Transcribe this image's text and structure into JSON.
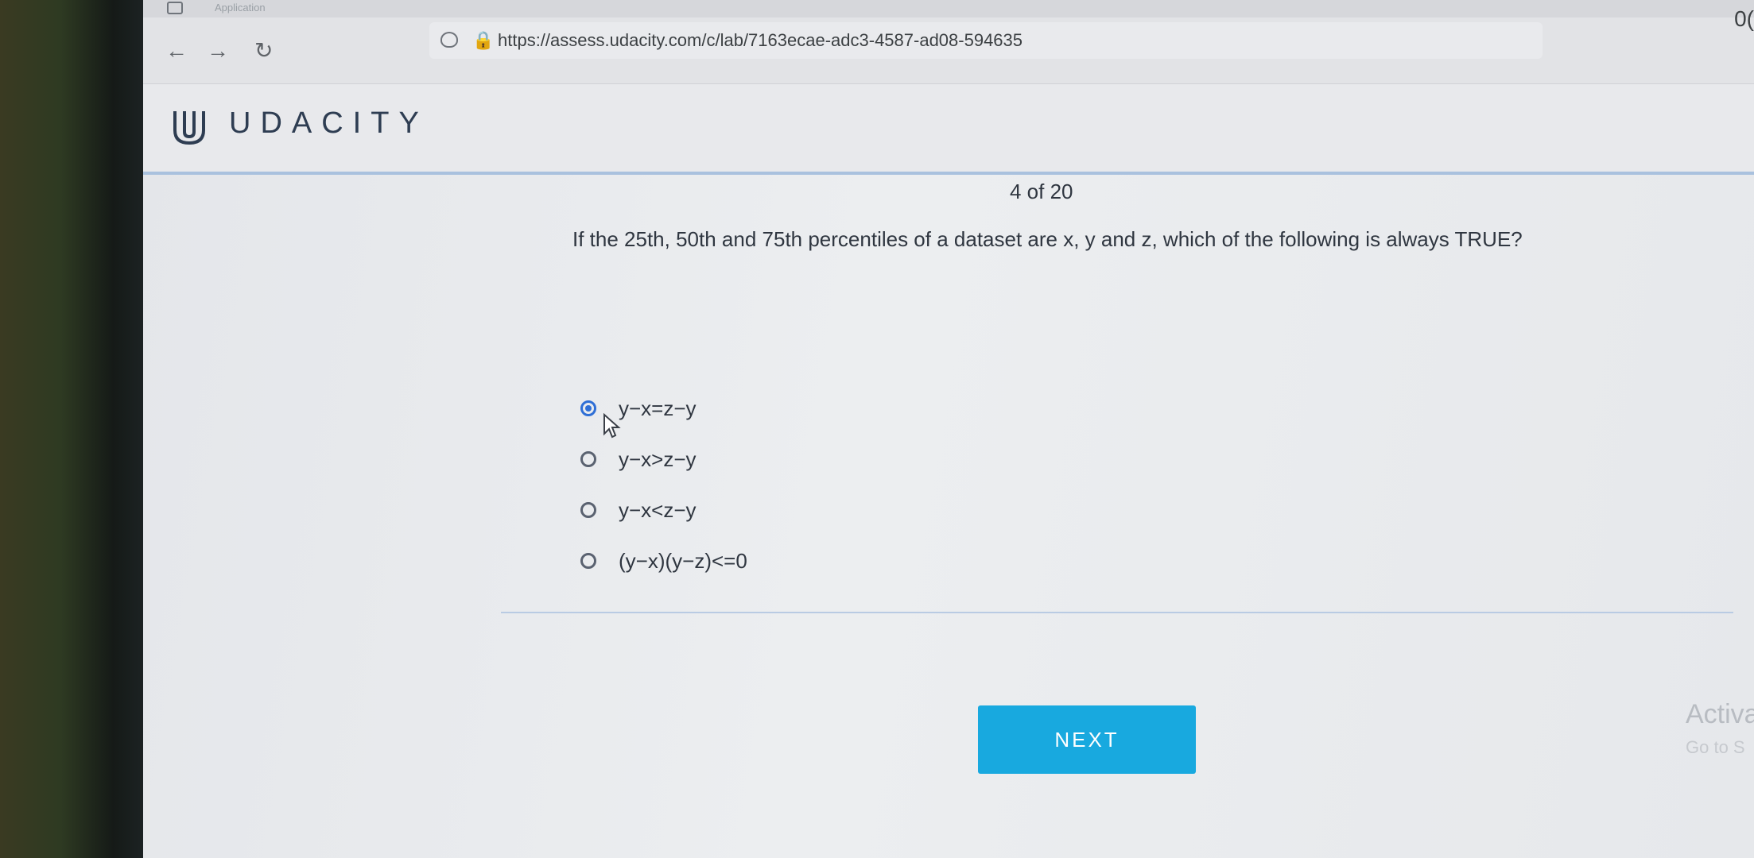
{
  "browser": {
    "tab_label": "Application",
    "url": "https://assess.udacity.com/c/lab/7163ecae-adc3-4587-ad08-594635",
    "corner_text": "0("
  },
  "header": {
    "logo_text": "UDACITY"
  },
  "quiz": {
    "counter": "4 of 20",
    "question": "If the 25th, 50th and 75th percentiles of a dataset are x, y and z, which of the following is always TRUE?",
    "options": [
      {
        "label": "y−x=z−y",
        "selected": true
      },
      {
        "label": "y−x>z−y",
        "selected": false
      },
      {
        "label": "y−x<z−y",
        "selected": false
      },
      {
        "label": "(y−x)(y−z)<=0",
        "selected": false
      }
    ],
    "next_label": "NEXT"
  },
  "overlay": {
    "activate_title": "Activa",
    "activate_sub": "Go to S"
  },
  "colors": {
    "accent": "#18a9df",
    "radio_selected": "#2f6fd6",
    "logo": "#2e3d52"
  }
}
